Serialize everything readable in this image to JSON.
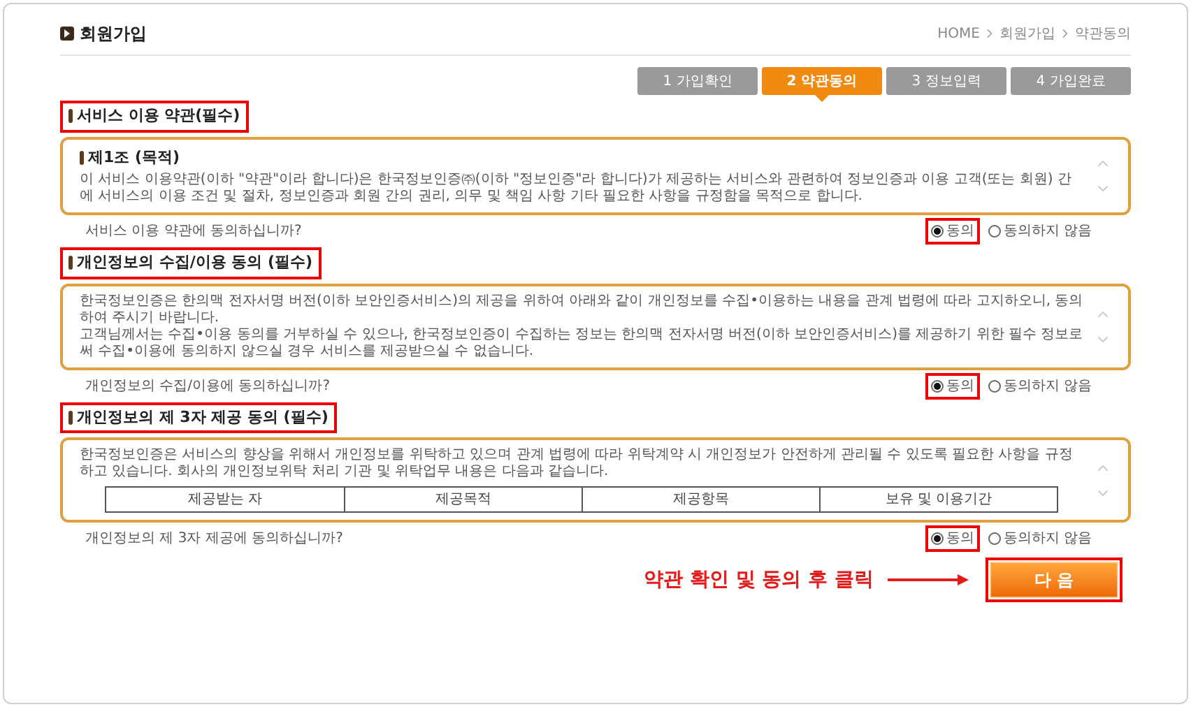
{
  "page_title": "회원가입",
  "breadcrumb": [
    "HOME",
    "회원가입",
    "약관동의"
  ],
  "steps": [
    {
      "label": "1 가입확인",
      "selected": false
    },
    {
      "label": "2 약관동의",
      "selected": true
    },
    {
      "label": "3 정보입력",
      "selected": false
    },
    {
      "label": "4 가입완료",
      "selected": false
    }
  ],
  "sections": [
    {
      "title": "서비스 이용 약관(필수)",
      "heading": "제1조 (목적)",
      "paragraphs": [
        "이 서비스 이용약관(이하 \"약관\"이라 합니다)은 한국정보인증㈜(이하 \"정보인증\"라 합니다)가 제공하는 서비스와 관련하여 정보인증과 이용 고객(또는 회원) 간에 서비스의 이용 조건 및 절차, 정보인증과 회원 간의 권리, 의무 및 책임 사항 기타 필요한 사항을 규정함을 목적으로 합니다."
      ],
      "question": "서비스 이용 약관에 동의하십니까?",
      "options": [
        {
          "label": "동의",
          "selected": true
        },
        {
          "label": "동의하지 않음",
          "selected": false
        }
      ]
    },
    {
      "title": "개인정보의 수집/이용 동의 (필수)",
      "paragraphs": [
        "한국정보인증은 한의맥 전자서명 버전(이하 보안인증서비스)의 제공을 위하여 아래와 같이 개인정보를 수집•이용하는 내용을 관계 법령에 따라 고지하오니, 동의하여 주시기 바랍니다.",
        "고객님께서는 수집•이용 동의를 거부하실 수 있으나, 한국정보인증이 수집하는 정보는 한의맥 전자서명 버전(이하 보안인증서비스)를 제공하기 위한 필수 정보로써 수집•이용에 동의하지 않으실 경우 서비스를 제공받으실 수 없습니다."
      ],
      "question": "개인정보의 수집/이용에 동의하십니까?",
      "options": [
        {
          "label": "동의",
          "selected": true
        },
        {
          "label": "동의하지 않음",
          "selected": false
        }
      ]
    },
    {
      "title": "개인정보의 제 3자 제공 동의 (필수)",
      "paragraphs": [
        "한국정보인증은 서비스의 향상을 위해서 개인정보를 위탁하고 있으며 관계 법령에 따라 위탁계약 시 개인정보가 안전하게 관리될 수 있도록 필요한 사항을 규정하고 있습니다. 회사의 개인정보위탁 처리 기관 및 위탁업무 내용은 다음과 같습니다."
      ],
      "table": {
        "columns": [
          "제공받는 자",
          "제공목적",
          "제공항목",
          "보유 및 이용기간"
        ]
      },
      "question": "개인정보의 제 3자 제공에 동의하십니까?",
      "options": [
        {
          "label": "동의",
          "selected": true
        },
        {
          "label": "동의하지 않음",
          "selected": false
        }
      ]
    }
  ],
  "instruction": "약관 확인 및 동의 후 클릭",
  "next_button": "다 음"
}
